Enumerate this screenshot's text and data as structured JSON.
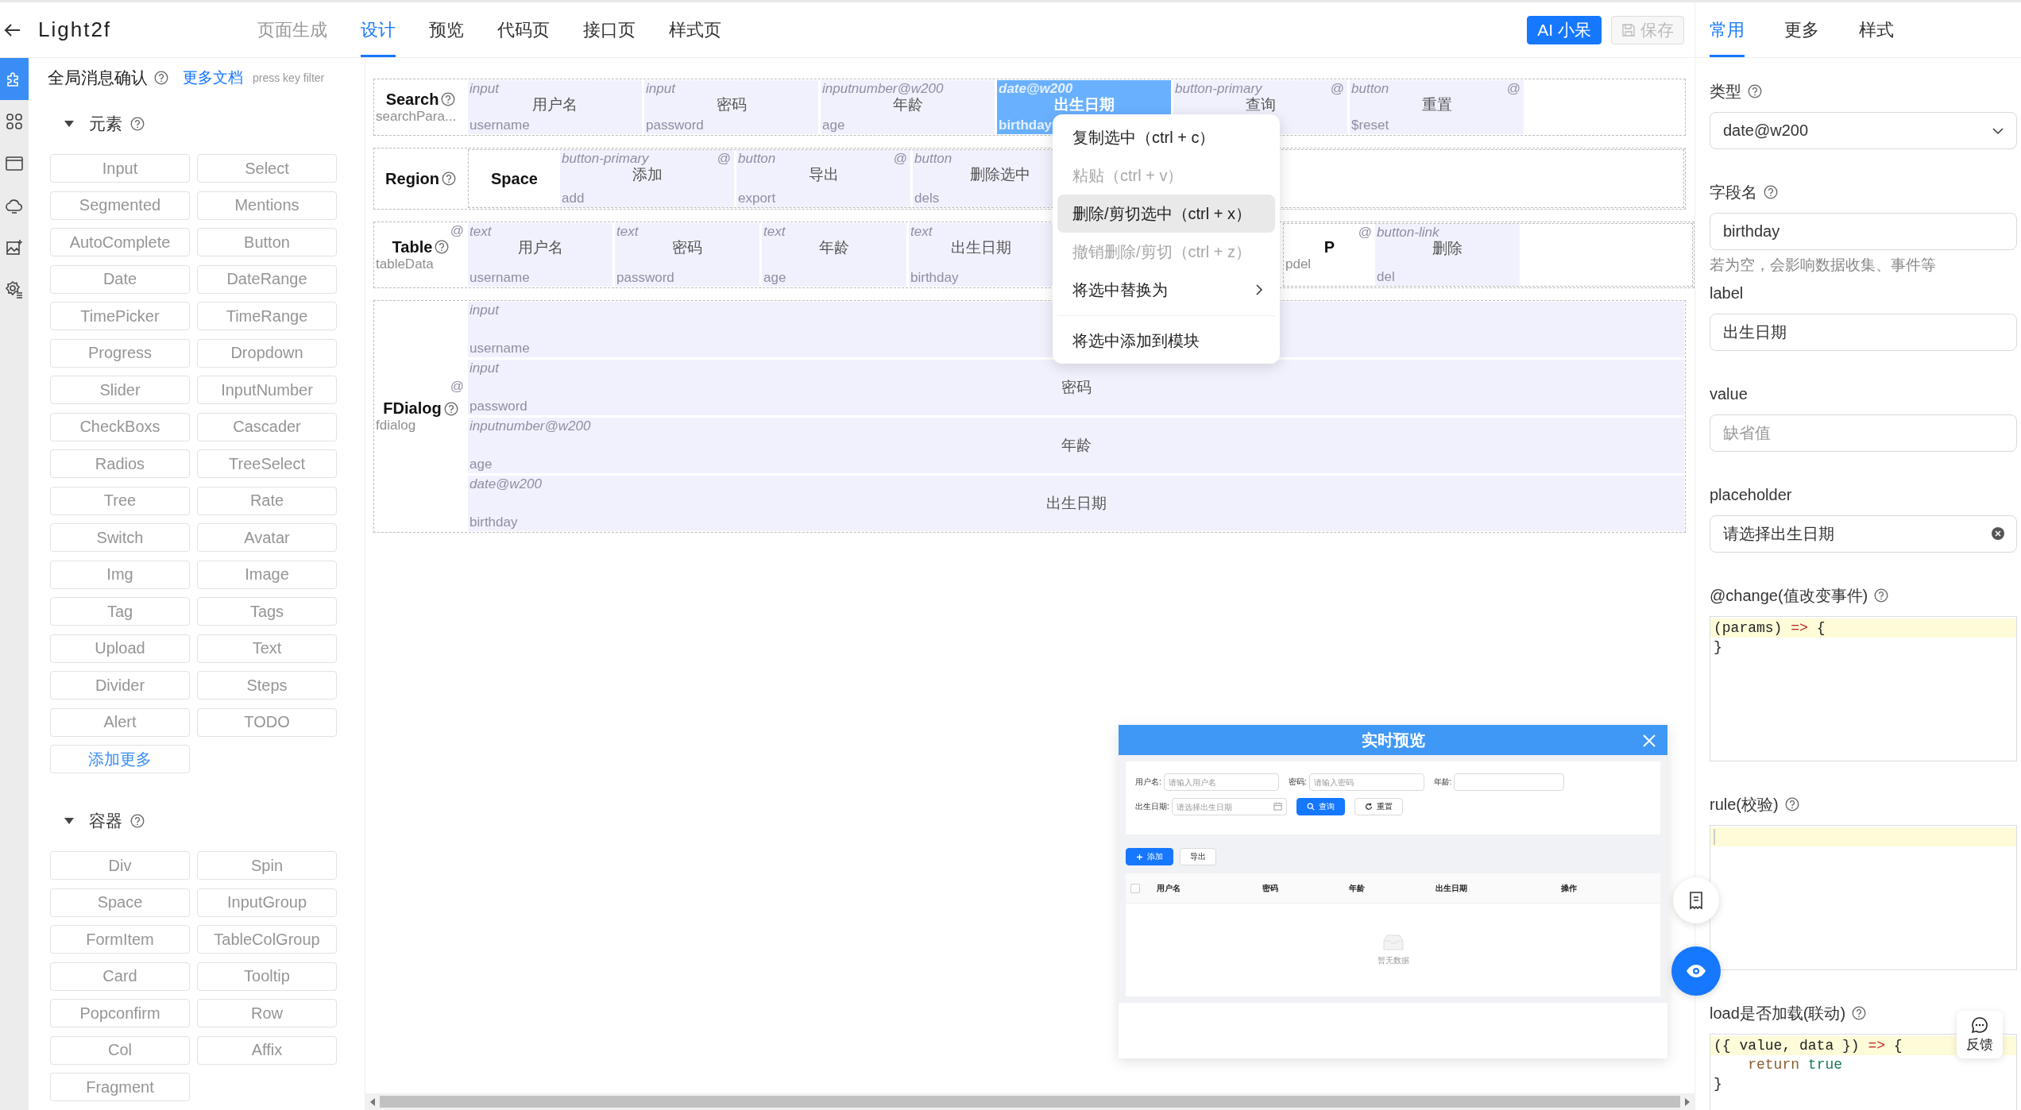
{
  "app": {
    "title": "Light2f"
  },
  "tabs": [
    {
      "label": "页面生成",
      "selected": false,
      "disabled": true
    },
    {
      "label": "设计",
      "selected": true,
      "disabled": false
    },
    {
      "label": "预览",
      "selected": false,
      "disabled": false
    },
    {
      "label": "代码页",
      "selected": false,
      "disabled": false
    },
    {
      "label": "接口页",
      "selected": false,
      "disabled": false
    },
    {
      "label": "样式页",
      "selected": false,
      "disabled": false
    }
  ],
  "actions": [
    {
      "kind": "primary",
      "label": "AI 小呆",
      "disabled": false
    },
    {
      "kind": "save",
      "label": "保存",
      "disabled": true
    }
  ],
  "sidebar": {
    "items": [
      {
        "selected": true
      },
      {
        "selected": false
      },
      {
        "selected": false
      },
      {
        "selected": false
      },
      {
        "selected": false
      },
      {
        "selected": false
      }
    ]
  },
  "palette": {
    "title": "全局消息确认",
    "docs_link": "更多文档",
    "filter_hint": "press key filter",
    "groups": [
      {
        "title": "元素",
        "expanded": true,
        "items": [
          "Input",
          "Select",
          "Segmented",
          "Mentions",
          "AutoComplete",
          "Button",
          "Date",
          "DateRange",
          "TimePicker",
          "TimeRange",
          "Progress",
          "Dropdown",
          "Slider",
          "InputNumber",
          "CheckBoxs",
          "Cascader",
          "Radios",
          "TreeSelect",
          "Tree",
          "Rate",
          "Switch",
          "Avatar",
          "Img",
          "Image",
          "Tag",
          "Tags",
          "Upload",
          "Text",
          "Divider",
          "Steps",
          "Alert",
          "TODO"
        ],
        "more": "添加更多"
      },
      {
        "title": "容器",
        "expanded": true,
        "items": [
          "Div",
          "Spin",
          "Space",
          "InputGroup",
          "FormItem",
          "TableColGroup",
          "Card",
          "Tooltip",
          "Popconfirm",
          "Row",
          "Col",
          "Affix",
          "Fragment"
        ]
      }
    ]
  },
  "canvas": {
    "blocks": [
      {
        "kind": "form",
        "title": "Search",
        "var": "searchPara...",
        "items": [
          {
            "kind": "field",
            "type": "input",
            "label": "用户名",
            "field": "username",
            "selected": false
          },
          {
            "kind": "field",
            "type": "input",
            "label": "密码",
            "field": "password",
            "selected": false
          },
          {
            "kind": "field",
            "type": "inputnumber@w200",
            "label": "年龄",
            "field": "age",
            "selected": false
          },
          {
            "kind": "field",
            "type": "date@w200",
            "label": "出生日期",
            "field": "birthday",
            "selected": true
          },
          {
            "kind": "field",
            "type": "button-primary",
            "label": "查询",
            "mark": "@",
            "selected": false
          },
          {
            "kind": "field",
            "type": "button",
            "label": "重置",
            "field": "$reset",
            "mark": "@",
            "selected": false
          }
        ]
      },
      {
        "kind": "region",
        "title": "Region",
        "items": [
          {
            "kind": "container",
            "title": "Space",
            "selected": false,
            "items": [
              {
                "kind": "field",
                "type": "button-primary",
                "label": "添加",
                "field": "add",
                "mark": "@",
                "selected": false
              },
              {
                "kind": "field",
                "type": "button",
                "label": "导出",
                "field": "export",
                "mark": "@",
                "selected": false
              },
              {
                "kind": "field",
                "type": "button",
                "label": "删除选中",
                "field": "dels",
                "selected": false
              }
            ]
          }
        ]
      },
      {
        "kind": "table",
        "title": "Table",
        "var": "tableData",
        "mark": "@",
        "items": [
          {
            "kind": "field",
            "type": "text",
            "label": "用户名",
            "field": "username",
            "selected": false
          },
          {
            "kind": "field",
            "type": "text",
            "label": "密码",
            "field": "password",
            "selected": false
          },
          {
            "kind": "field",
            "type": "text",
            "label": "年龄",
            "field": "age",
            "selected": false
          },
          {
            "kind": "field",
            "type": "text",
            "label": "出生日期",
            "field": "birthday",
            "selected": false
          },
          {
            "kind": "container",
            "title": "P",
            "field": "pdel",
            "mark": "@",
            "selected": false,
            "items": [
              {
                "kind": "field",
                "type": "button-link",
                "label": "删除",
                "field": "del",
                "selected": false
              }
            ]
          }
        ]
      },
      {
        "kind": "dialog",
        "title": "FDialog",
        "var": "fdialog",
        "mark": "@",
        "items": [
          {
            "kind": "field",
            "type": "input",
            "field": "username",
            "selected": false
          },
          {
            "kind": "field",
            "type": "input",
            "label": "密码",
            "field": "password",
            "selected": false
          },
          {
            "kind": "field",
            "type": "inputnumber@w200",
            "label": "年龄",
            "field": "age",
            "selected": false
          },
          {
            "kind": "field",
            "type": "date@w200",
            "label": "出生日期",
            "field": "birthday",
            "selected": false
          }
        ]
      }
    ]
  },
  "context_menu": {
    "groups": [
      {
        "items": [
          {
            "label": "复制选中（ctrl + c）",
            "disabled": false,
            "highlighted": false,
            "submenu": false
          },
          {
            "label": "粘贴（ctrl + v）",
            "disabled": true,
            "highlighted": false,
            "submenu": false
          },
          {
            "label": "删除/剪切选中（ctrl + x）",
            "disabled": false,
            "highlighted": true,
            "submenu": false
          },
          {
            "label": "撤销删除/剪切（ctrl + z）",
            "disabled": true,
            "highlighted": false,
            "submenu": false
          },
          {
            "label": "将选中替换为",
            "disabled": false,
            "highlighted": false,
            "submenu": true
          }
        ]
      },
      {
        "items": [
          {
            "label": "将选中添加到模块",
            "disabled": false,
            "highlighted": false,
            "submenu": false
          }
        ]
      }
    ]
  },
  "preview": {
    "title": "实时预览",
    "search_fields": [
      {
        "kind": "input",
        "label": "用户名:",
        "placeholder": "请输入用户名"
      },
      {
        "kind": "input",
        "label": "密码:",
        "placeholder": "请输入密码"
      },
      {
        "kind": "input",
        "label": "年龄:"
      },
      {
        "kind": "date",
        "label": "出生日期:",
        "placeholder": "请选择出生日期"
      }
    ],
    "search_buttons": [
      {
        "kind": "primary",
        "label": "查询"
      },
      {
        "kind": "default",
        "label": "重置"
      }
    ],
    "toolbar": [
      {
        "kind": "primary",
        "label": "添加"
      },
      {
        "kind": "default",
        "label": "导出"
      }
    ],
    "select_all": {
      "checked": false
    },
    "columns": [
      "用户名",
      "密码",
      "年龄",
      "出生日期",
      "操作"
    ],
    "empty": "暂无数据"
  },
  "inspector": {
    "tabs": [
      {
        "label": "常用",
        "selected": true
      },
      {
        "label": "更多",
        "selected": false
      },
      {
        "label": "样式",
        "selected": false
      }
    ],
    "fields": [
      {
        "kind": "select",
        "label": "类型",
        "help": true,
        "value": "date@w200"
      },
      {
        "kind": "input",
        "label": "字段名",
        "help": true,
        "value": "birthday",
        "hint": "若为空，会影响数据收集、事件等",
        "clearable": false
      },
      {
        "kind": "input",
        "label": "label",
        "help": false,
        "value": "出生日期",
        "clearable": false
      },
      {
        "kind": "input",
        "label": "value",
        "help": false,
        "placeholder": "缺省值",
        "clearable": false
      },
      {
        "kind": "input",
        "label": "placeholder",
        "help": false,
        "value": "请选择出生日期",
        "clearable": true
      },
      {
        "kind": "code",
        "label": "@change(值改变事件)",
        "help": true,
        "lines": [
          "(params) => {",
          "}"
        ]
      },
      {
        "kind": "code",
        "label": "rule(校验)",
        "help": true
      },
      {
        "kind": "code",
        "label": "load是否加载(联动)",
        "help": true,
        "lines": [
          "({ value, data }) => {",
          "    return true",
          "}"
        ]
      }
    ]
  },
  "feedback": {
    "label": "反馈"
  }
}
